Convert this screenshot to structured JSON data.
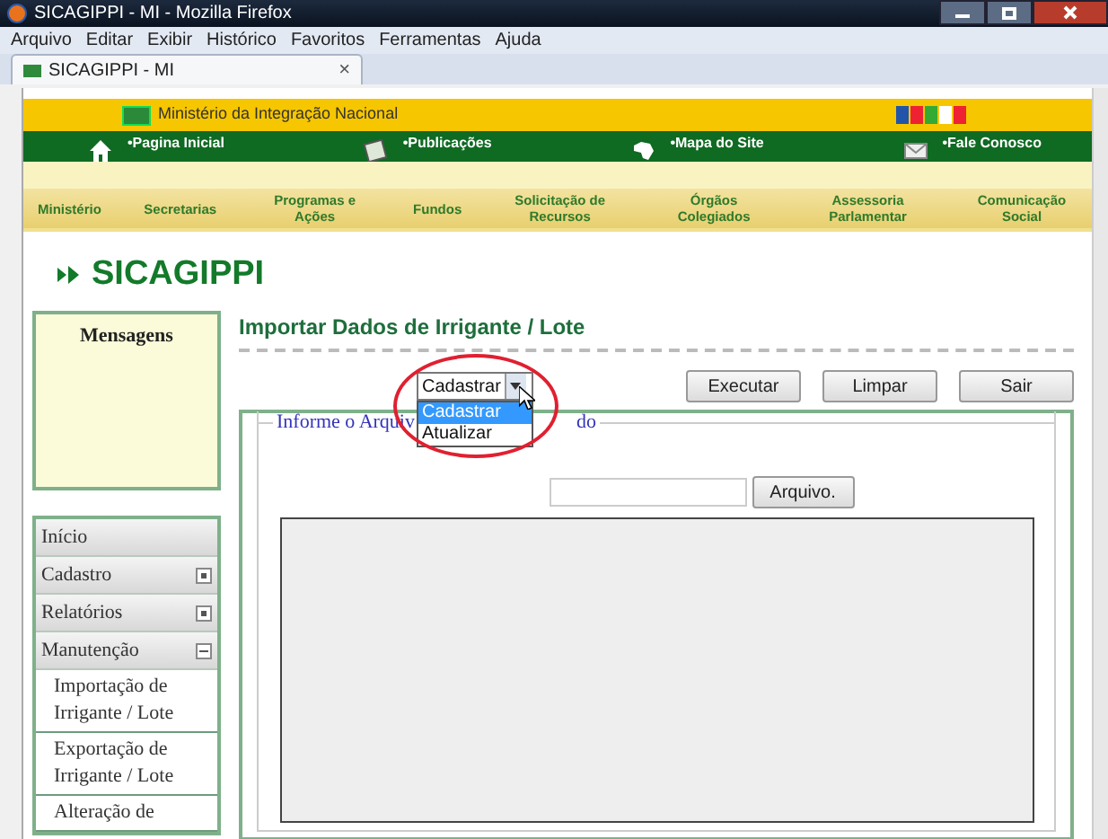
{
  "window": {
    "title": "SICAGIPPI - MI - Mozilla Firefox"
  },
  "menu": [
    "Arquivo",
    "Editar",
    "Exibir",
    "Histórico",
    "Favoritos",
    "Ferramentas",
    "Ajuda"
  ],
  "tabs": [
    {
      "label": "SICAGIPPI - MI",
      "selected": true,
      "close": "×"
    }
  ],
  "header": {
    "ministry": "Ministério da Integração Nacional",
    "quick_links": [
      {
        "kind": "home",
        "label": "•Pagina Inicial"
      },
      {
        "kind": "book",
        "label": "•Publicações"
      },
      {
        "kind": "map",
        "label": "•Mapa do Site"
      },
      {
        "kind": "mail",
        "label": "•Fale Conosco"
      }
    ],
    "nav": [
      "Ministério",
      "Secretarias",
      "Programas e Ações",
      "Fundos",
      "Solicitação de Recursos",
      "Órgãos Colegiados",
      "Assessoria Parlamentar",
      "Comunicação Social"
    ]
  },
  "app_title": "SICAGIPPI",
  "messages": {
    "title": "Mensagens"
  },
  "sidebar": {
    "items": [
      {
        "label": "Início"
      },
      {
        "label": "Cadastro",
        "expanded": false
      },
      {
        "label": "Relatórios",
        "expanded": false
      },
      {
        "label": "Manutenção",
        "expanded": true,
        "children": [
          {
            "label": "Importação de Irrigante / Lote"
          },
          {
            "label": "Exportação de Irrigante / Lote"
          },
          {
            "label": "Alteração de"
          }
        ]
      }
    ]
  },
  "page_title": "Importar Dados de Irrigante / Lote",
  "action_select": {
    "value": "Cadastrar",
    "open": true,
    "options": [
      {
        "label": "Cadastrar",
        "selected": true
      },
      {
        "label": "Atualizar",
        "selected": false
      }
    ]
  },
  "buttons": [
    "Executar",
    "Limpar",
    "Sair"
  ],
  "file_section": {
    "legend_parts": [
      "Informe o Arquiv",
      "do"
    ],
    "file_button": "Arquivo."
  }
}
